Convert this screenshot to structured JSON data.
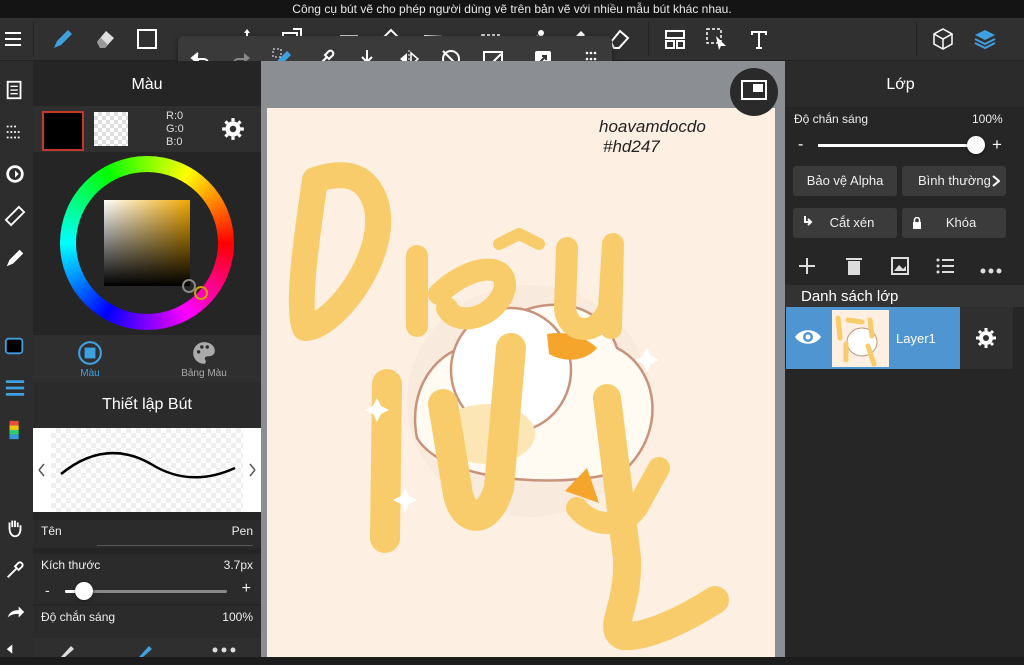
{
  "caption": "Công cụ bút vẽ cho phép người dùng vẽ trên bản vẽ với nhiều mẫu bút khác nhau.",
  "toolbar": {
    "icons": [
      "menu-icon",
      "pen-icon",
      "eraser-icon",
      "rectangle-icon",
      "brush-icon",
      "move-icon",
      "transform-icon",
      "fill-icon",
      "bucket-icon",
      "gradient-icon",
      "select-rect-icon",
      "magic-wand-icon",
      "select-pen-icon",
      "select-eraser-icon",
      "layout-icon",
      "select-arrow-icon",
      "text-icon",
      "3d-material-icon",
      "layers-icon"
    ]
  },
  "subtoolbar": {
    "icons": [
      "undo-icon",
      "redo-icon",
      "auto-select-icon",
      "eyedropper-icon",
      "save-icon",
      "flip-icon",
      "rotate-icon",
      "clear-icon",
      "export-icon",
      "grid-icon"
    ]
  },
  "color_panel": {
    "title": "Màu",
    "r": "R:0",
    "g": "G:0",
    "b": "B:0",
    "tab_color": "Màu",
    "tab_palette": "Bảng Màu",
    "fg_color": "#000000"
  },
  "brush_settings": {
    "title": "Thiết lập Bút",
    "name_label": "Tên",
    "name_value": "Pen",
    "size_label": "Kích thước",
    "size_value": "3.7px",
    "size_minus": "-",
    "size_plus": "+",
    "size_fraction": 0.12,
    "opacity_label": "Độ chắn sáng",
    "opacity_value": "100%"
  },
  "canvas": {
    "signature_line1": "hoavamdocdo",
    "signature_line2": "#hd247",
    "art_text_line1": "Diệu",
    "art_text_line2": "Vy"
  },
  "layer_panel": {
    "title": "Lớp",
    "opacity_label": "Độ chắn sáng",
    "opacity_value": "100%",
    "opacity_fraction": 1.0,
    "opacity_minus": "-",
    "opacity_plus": "+",
    "protect_alpha": "Bảo vệ Alpha",
    "blend_mode": "Bình thường",
    "clipping": "Cắt xén",
    "lock": "Khóa",
    "list_title": "Danh sách lớp",
    "layers": [
      {
        "name": "Layer1"
      }
    ]
  },
  "colors": {
    "accent": "#4f95d2",
    "layer_icon_blue": "#3fa0e0",
    "art_yellow": "#f9cc6b",
    "canvas_bg": "#fdf0e2"
  }
}
